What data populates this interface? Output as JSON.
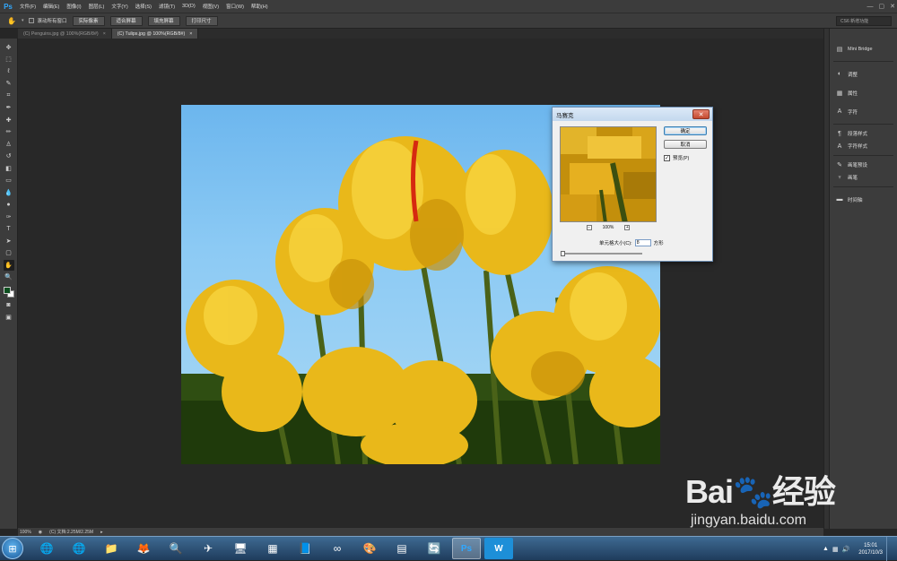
{
  "app": {
    "logo": "Ps"
  },
  "menu": [
    "文件(F)",
    "编辑(E)",
    "图像(I)",
    "图层(L)",
    "文字(Y)",
    "选择(S)",
    "滤镜(T)",
    "3D(D)",
    "视图(V)",
    "窗口(W)",
    "帮助(H)"
  ],
  "options": {
    "scroll_all_label": "滚动所有窗口",
    "buttons": [
      "实际像素",
      "适合屏幕",
      "填充屏幕",
      "打印尺寸"
    ],
    "workspace": "CS6 新增功能"
  },
  "tabs": [
    {
      "label": "(C) Penguins.jpg @ 100%(RGB/8#)",
      "close": "×"
    },
    {
      "label": "(C) Tulips.jpg @ 100%(RGB/8#)",
      "close": "×"
    }
  ],
  "tools": [
    "move-tool",
    "marquee-tool",
    "lasso-tool",
    "quick-select-tool",
    "crop-tool",
    "eyedropper-tool",
    "spot-heal-tool",
    "brush-tool",
    "clone-stamp-tool",
    "history-brush-tool",
    "eraser-tool",
    "gradient-tool",
    "blur-tool",
    "dodge-tool",
    "pen-tool",
    "type-tool",
    "path-select-tool",
    "rectangle-tool",
    "hand-tool",
    "zoom-tool"
  ],
  "tool_glyphs": [
    "✥",
    "⬚",
    "ℓ",
    "✎",
    "⌗",
    "✒",
    "✚",
    "✏",
    "♙",
    "↺",
    "◧",
    "▭",
    "💧",
    "●",
    "✑",
    "T",
    "➤",
    "▢",
    "✋",
    "🔍"
  ],
  "colors": {
    "foreground": "#0d4f1f",
    "background": "#ffffff",
    "accent": "#31a8ff"
  },
  "panels": [
    {
      "icon": "mini-bridge-icon",
      "glyph": "▤",
      "label": "Mini Bridge"
    },
    {
      "icon": "adjustments-icon",
      "glyph": "◐",
      "label": "调整"
    },
    {
      "icon": "properties-icon",
      "glyph": "▦",
      "label": "属性"
    },
    {
      "icon": "character-icon",
      "glyph": "A",
      "label": "字符"
    },
    {
      "icon": "paragraph-styles-icon",
      "glyph": "¶",
      "label": "段落样式"
    },
    {
      "icon": "character-styles-icon",
      "glyph": "A",
      "label": "字符样式"
    },
    {
      "icon": "brush-presets-icon",
      "glyph": "✎",
      "label": "画笔预设"
    },
    {
      "icon": "brush-icon",
      "glyph": "♆",
      "label": "画笔"
    },
    {
      "icon": "timeline-icon",
      "glyph": "▬",
      "label": "时间轴"
    }
  ],
  "status": {
    "zoom": "100%",
    "doc": "(C) 文档:2.25M/2.25M"
  },
  "dialog": {
    "title": "马赛克",
    "close": "✕",
    "ok": "确定",
    "cancel": "取消",
    "preview_label": "预览(P)",
    "preview_check": "✓",
    "zoom_out": "−",
    "zoom": "100%",
    "zoom_in": "+",
    "cell_label": "单元格大小(C):",
    "cell_value": "8",
    "cell_unit": "方形",
    "slider_value": 0.0
  },
  "taskbar": {
    "apps": [
      "🌐",
      "🌐",
      "📁",
      "🦊",
      "🔍",
      "✈",
      "🖥",
      "▦",
      "📘",
      "∞",
      "🎨",
      "▤",
      "🔄",
      "Ps",
      "W"
    ],
    "clock_time": "15:01",
    "clock_date": "2017/10/3"
  },
  "watermark": {
    "logo": "Bai🐾经验",
    "url": "jingyan.baidu.com"
  }
}
